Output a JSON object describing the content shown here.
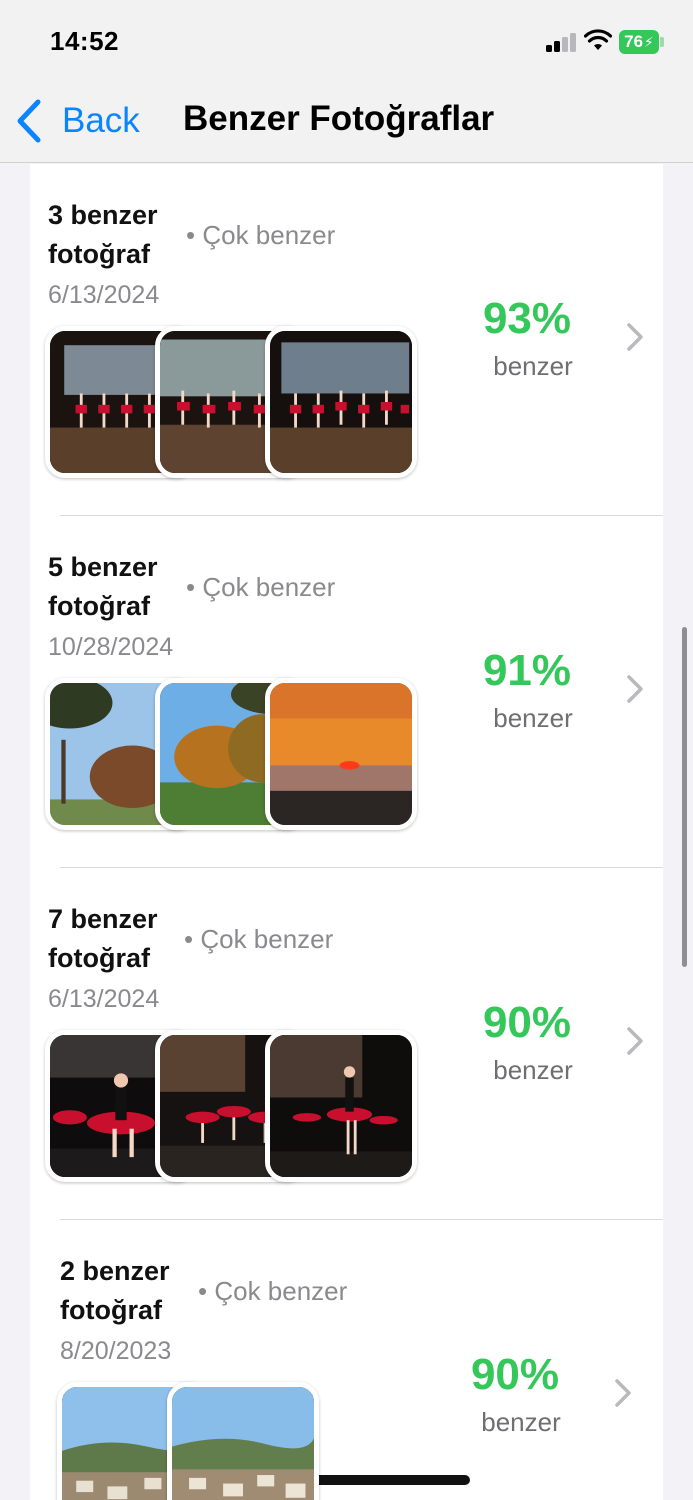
{
  "status_bar": {
    "time": "14:52",
    "battery": "76",
    "icons": [
      "signal-icon",
      "wifi-icon",
      "battery-charging-icon"
    ],
    "battery_color": "#34c759"
  },
  "nav": {
    "back_label": "Back",
    "title": "Benzer Fotoğraflar",
    "accent_color": "#0a84ff"
  },
  "groups": [
    {
      "title": "3 benzer fotoğraf",
      "similarity": "• Çok benzer",
      "date": "6/13/2024",
      "percent": "93%",
      "percent_label": "benzer",
      "thumbnails": [
        "ballet-stage-photo",
        "ballet-stage-photo",
        "ballet-stage-photo"
      ]
    },
    {
      "title": "5 benzer fotoğraf",
      "similarity": "• Çok benzer",
      "date": "10/28/2024",
      "percent": "91%",
      "percent_label": "benzer",
      "thumbnails": [
        "park-trees-photo",
        "autumn-trees-photo",
        "sunset-sea-photo"
      ]
    },
    {
      "title": "7 benzer fotoğraf",
      "similarity": "• Çok benzer",
      "date": "6/13/2024",
      "percent": "90%",
      "percent_label": "benzer",
      "thumbnails": [
        "ballet-dancers-photo",
        "ballet-dancers-photo",
        "ballet-dancers-photo"
      ]
    },
    {
      "title": "2 benzer fotoğraf",
      "similarity": "• Çok benzer",
      "date": "8/20/2023",
      "percent": "90%",
      "percent_label": "benzer",
      "thumbnails": [
        "village-landscape-photo",
        "village-landscape-photo"
      ]
    }
  ],
  "colors": {
    "percent": "#34c759",
    "secondary_text": "#8a8a8e",
    "background": "#f2f2f7"
  }
}
